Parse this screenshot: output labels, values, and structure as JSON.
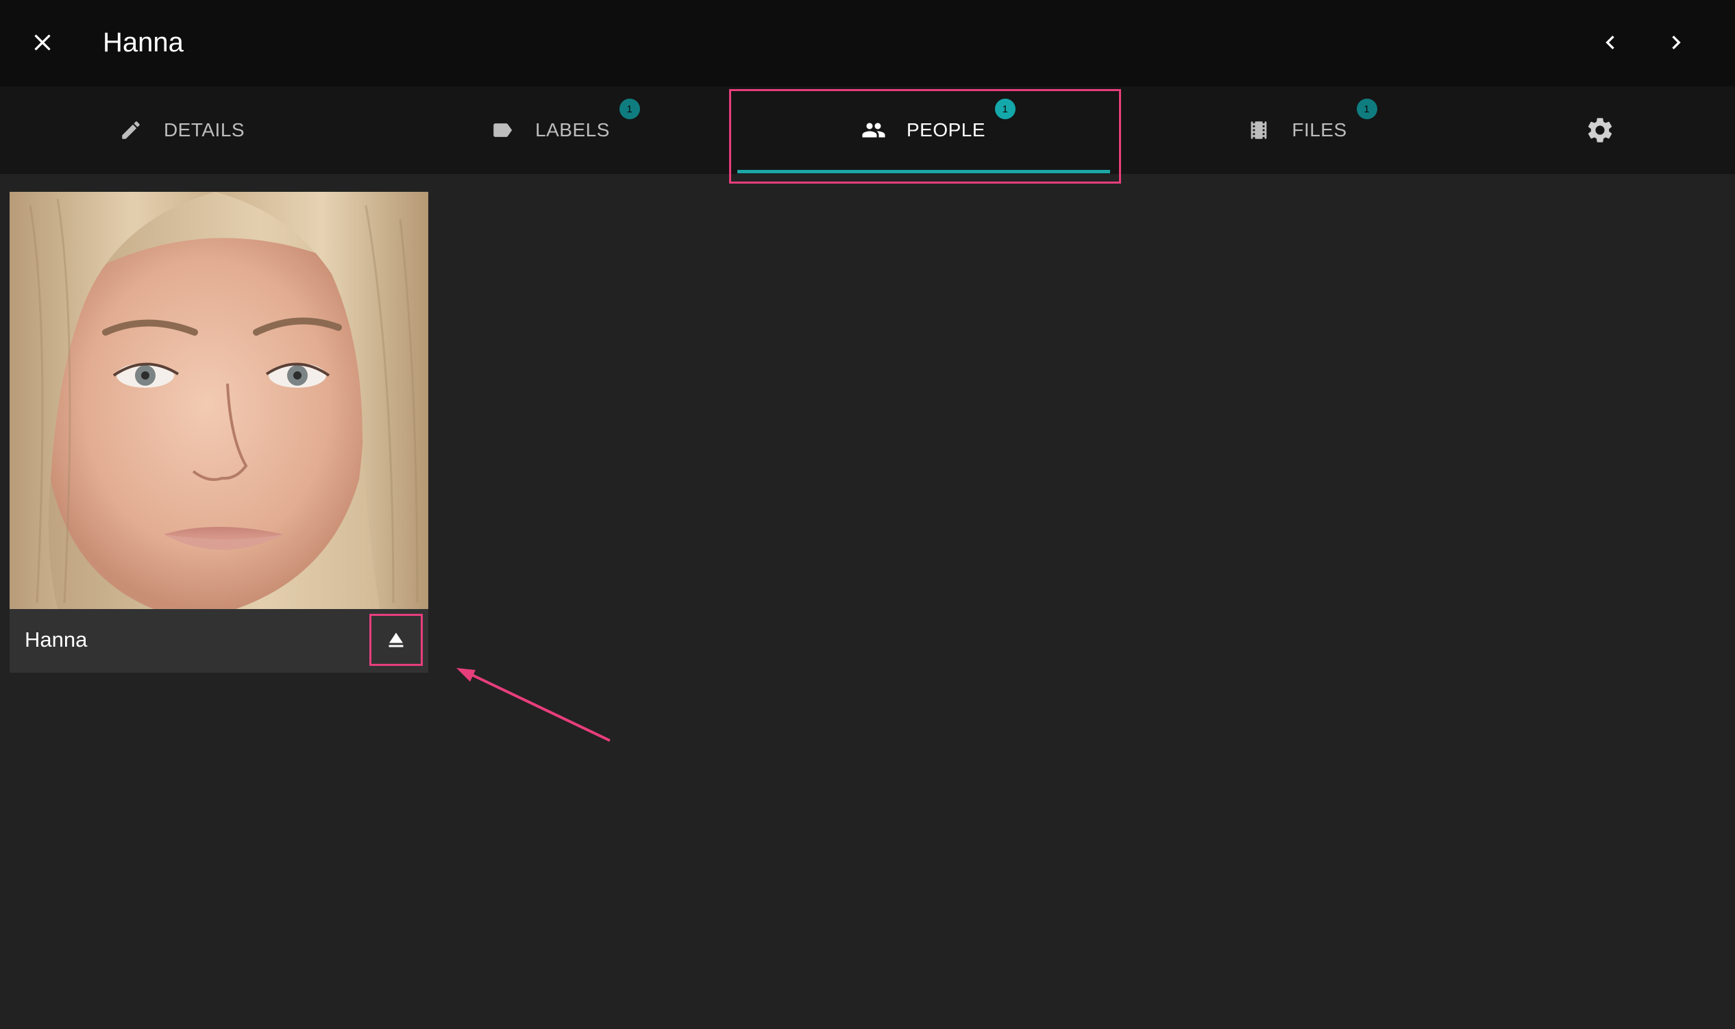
{
  "header": {
    "title": "Hanna",
    "close_icon": "close-icon",
    "prev_icon": "chevron-left-icon",
    "next_icon": "chevron-right-icon"
  },
  "tabs": [
    {
      "label": "DETAILS",
      "icon": "pencil-icon",
      "badge": ""
    },
    {
      "label": "LABELS",
      "icon": "label-tag-icon",
      "badge": "1"
    },
    {
      "label": "PEOPLE",
      "icon": "people-icon",
      "badge": "1",
      "active": true
    },
    {
      "label": "FILES",
      "icon": "film-icon",
      "badge": "1"
    },
    {
      "label": "",
      "icon": "gear-icon",
      "badge": ""
    }
  ],
  "people": [
    {
      "name": "Hanna",
      "action_icon": "eject-icon"
    }
  ],
  "colors": {
    "accent": "#1ca7a6",
    "annotation": "#e83e7c",
    "badge": "#0f7d80",
    "background": "#222222",
    "topbar": "#0d0d0d",
    "tabbar": "#151515"
  }
}
